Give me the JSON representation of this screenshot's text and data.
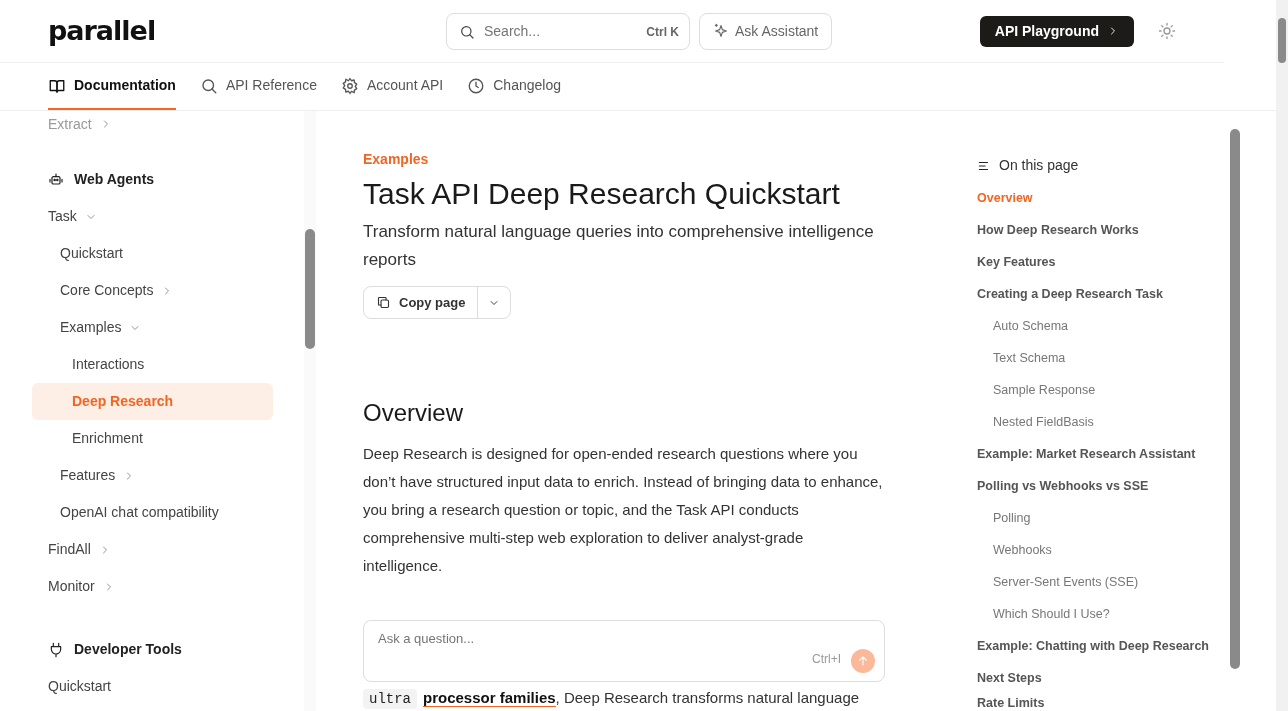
{
  "header": {
    "logo": "parallel",
    "search": {
      "placeholder": "Search...",
      "shortcut": "Ctrl K"
    },
    "assistant_button": "Ask Assistant",
    "playground_button": "API Playground"
  },
  "tabs": [
    {
      "label": "Documentation",
      "selected": true
    },
    {
      "label": "API Reference",
      "selected": false
    },
    {
      "label": "Account API",
      "selected": false
    },
    {
      "label": "Changelog",
      "selected": false
    }
  ],
  "sidebar": {
    "items": [
      {
        "kind": "link",
        "label": "Extract",
        "faded": true,
        "expanded": false,
        "selected": false
      },
      {
        "kind": "section",
        "label": "Web Agents"
      },
      {
        "kind": "link",
        "label": "Task",
        "expanded": true,
        "selected": false,
        "children": [
          {
            "kind": "link",
            "label": "Quickstart",
            "selected": false
          },
          {
            "kind": "link",
            "label": "Core Concepts",
            "expanded": false,
            "selected": false
          },
          {
            "kind": "link",
            "label": "Examples",
            "expanded": true,
            "selected": false,
            "children": [
              {
                "kind": "link",
                "label": "Interactions",
                "selected": false
              },
              {
                "kind": "link",
                "label": "Deep Research",
                "selected": true
              },
              {
                "kind": "link",
                "label": "Enrichment",
                "selected": false
              }
            ]
          },
          {
            "kind": "link",
            "label": "Features",
            "expanded": false,
            "selected": false
          },
          {
            "kind": "link",
            "label": "OpenAI chat compatibility",
            "selected": false
          }
        ]
      },
      {
        "kind": "link",
        "label": "FindAll",
        "expanded": false,
        "selected": false
      },
      {
        "kind": "link",
        "label": "Monitor",
        "expanded": false,
        "selected": false
      },
      {
        "kind": "section",
        "label": "Developer Tools"
      },
      {
        "kind": "link",
        "label": "Quickstart",
        "selected": false
      }
    ]
  },
  "article": {
    "eyebrow": "Examples",
    "title": "Task API Deep Research Quickstart",
    "subtitle": "Transform natural language queries into comprehensive intelligence reports",
    "copy_button": "Copy page",
    "heading": "Overview",
    "paragraphs": [
      [
        {
          "kind": "text",
          "text": "Deep Research is designed for open-ended research questions where you don’t have structured input data to enrich. Instead of bringing data to enhance, you bring a research question or topic, and the Task API conducts comprehensive multi-step web exploration to deliver analyst-grade intelligence."
        }
      ],
      [
        {
          "kind": "code",
          "text": "ultra"
        },
        {
          "kind": "link",
          "text": "processor families"
        },
        {
          "kind": "text",
          "text": ", Deep Research transforms natural language"
        }
      ]
    ]
  },
  "ask_box": {
    "placeholder": "Ask a question...",
    "shortcut": "Ctrl+I"
  },
  "toc": {
    "title": "On this page",
    "items": [
      {
        "label": "Overview",
        "selected": true
      },
      {
        "label": "How Deep Research Works",
        "selected": false
      },
      {
        "label": "Key Features",
        "selected": false
      },
      {
        "label": "Creating a Deep Research Task",
        "selected": false,
        "children": [
          {
            "label": "Auto Schema",
            "selected": false
          },
          {
            "label": "Text Schema",
            "selected": false
          },
          {
            "label": "Sample Response",
            "selected": false
          },
          {
            "label": "Nested FieldBasis",
            "selected": false
          }
        ]
      },
      {
        "label": "Example: Market Research Assistant",
        "selected": false
      },
      {
        "label": "Polling vs Webhooks vs SSE",
        "selected": false,
        "children": [
          {
            "label": "Polling",
            "selected": false
          },
          {
            "label": "Webhooks",
            "selected": false
          },
          {
            "label": "Server-Sent Events (SSE)",
            "selected": false
          },
          {
            "label": "Which Should I Use?",
            "selected": false
          }
        ]
      },
      {
        "label": "Example: Chatting with Deep Research",
        "selected": false
      },
      {
        "label": "Next Steps",
        "selected": false
      },
      {
        "label": "Rate Limits",
        "selected": false
      }
    ]
  }
}
